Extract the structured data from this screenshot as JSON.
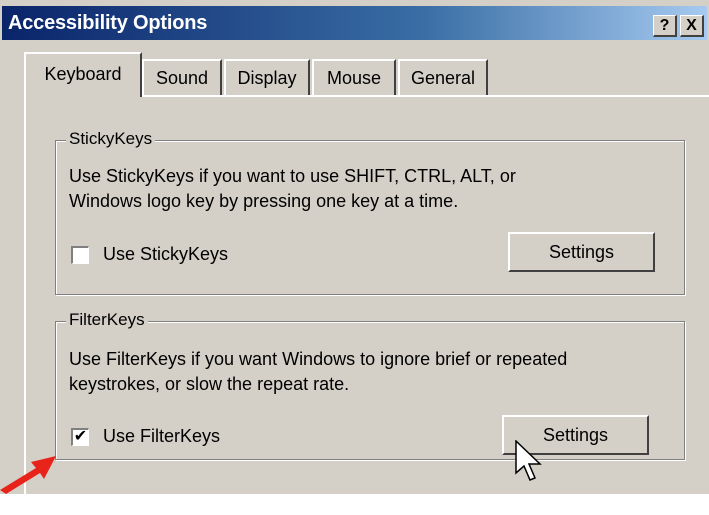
{
  "window": {
    "title": "Accessibility Options",
    "help_button": "?",
    "close_button": "X"
  },
  "tabs": [
    {
      "label": "Keyboard",
      "active": true
    },
    {
      "label": "Sound",
      "active": false
    },
    {
      "label": "Display",
      "active": false
    },
    {
      "label": "Mouse",
      "active": false
    },
    {
      "label": "General",
      "active": false
    }
  ],
  "sticky_keys": {
    "group_label": "StickyKeys",
    "description_line1": "Use StickyKeys if you want to use SHIFT, CTRL, ALT, or",
    "description_line2": "Windows logo key by pressing one key at a time.",
    "checkbox_label": "Use StickyKeys",
    "checked": false,
    "settings_label": "Settings"
  },
  "filter_keys": {
    "group_label": "FilterKeys",
    "description_line1": "Use FilterKeys if you want Windows to ignore brief or repeated",
    "description_line2": "keystrokes, or slow the repeat rate.",
    "checkbox_label": "Use FilterKeys",
    "checked": true,
    "check_mark": "✔",
    "settings_label": "Settings"
  },
  "annotation": {
    "arrow_icon": "red-arrow-icon",
    "arrow_color": "#e8231a"
  }
}
